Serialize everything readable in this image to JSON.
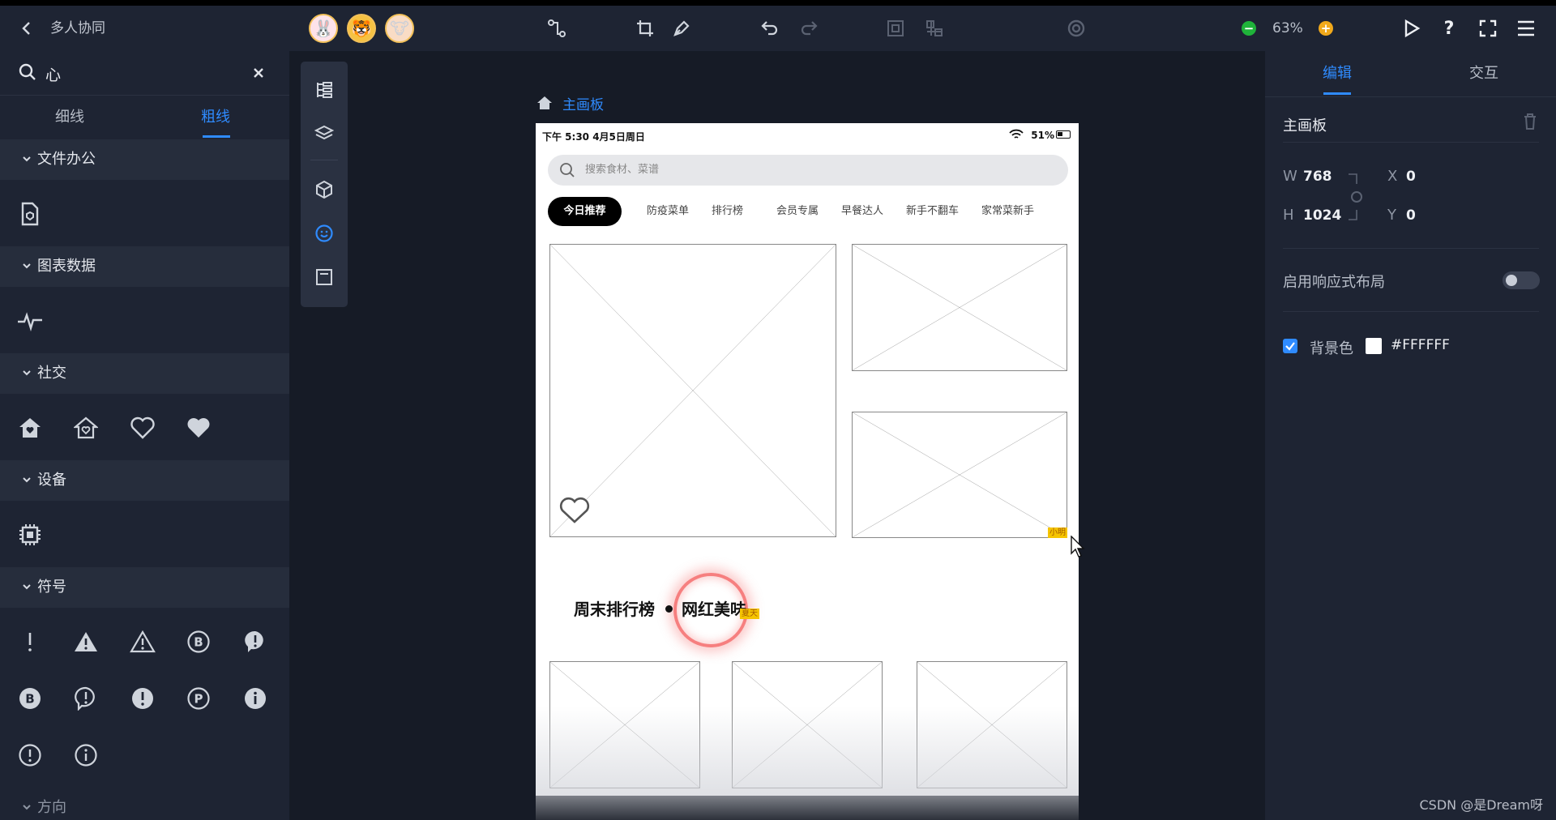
{
  "topbar": {
    "title": "多人协同",
    "avatars": [
      "🐰",
      "🐯",
      "🐮"
    ],
    "zoom": "63%",
    "zoom_out": "−",
    "zoom_in": "+"
  },
  "left_panel": {
    "search_value": "心",
    "tabs": [
      "细线",
      "粗线"
    ],
    "active_tab": "粗线",
    "categories": [
      "文件办公",
      "图表数据",
      "社交",
      "设备",
      "符号",
      "方向"
    ]
  },
  "canvas": {
    "breadcrumb": "主画板",
    "status_time": "下午 5:30 4月5日周日",
    "status_battery": "51%",
    "search_placeholder": "搜索食材、菜谱",
    "categories": [
      "今日推荐",
      "防疫菜单",
      "排行榜",
      "会员专属",
      "早餐达人",
      "新手不翻车",
      "家常菜新手"
    ],
    "section_title_1": "周末排行榜",
    "section_title_2": "网红美味",
    "tag_1": "小明",
    "tag_2": "夏天"
  },
  "right_panel": {
    "tabs": [
      "编辑",
      "交互"
    ],
    "title": "主画板",
    "w_label": "W",
    "w_value": "768",
    "h_label": "H",
    "h_value": "1024",
    "x_label": "X",
    "x_value": "0",
    "y_label": "Y",
    "y_value": "0",
    "responsive_label": "启用响应式布局",
    "bg_label": "背景色",
    "bg_value": "#FFFFFF"
  },
  "watermark": "CSDN @是Dream呀",
  "colors": {
    "accent": "#2f8bff",
    "panel": "#1e2433",
    "canvas_bg": "#161b26"
  }
}
